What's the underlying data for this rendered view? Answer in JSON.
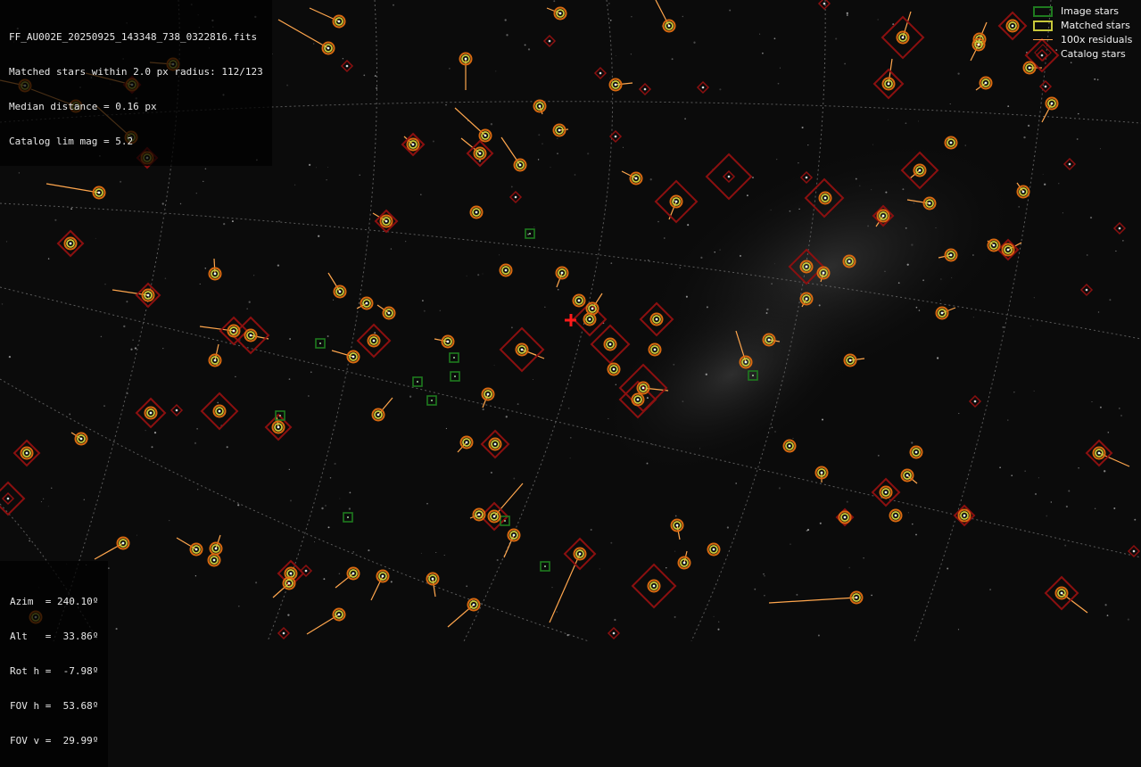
{
  "header": {
    "filename": "FF_AU002E_20250925_143348_738_0322816.fits",
    "matched_line": "Matched stars within 2.0 px radius: 112/123",
    "median_line": "Median distance = 0.16 px",
    "catalog_line": "Catalog lim mag = 5.2"
  },
  "legend": {
    "image_stars": "Image stars",
    "matched_stars": "Matched stars",
    "residuals": "100x residuals",
    "catalog_stars": "Catalog stars"
  },
  "pointing": {
    "azim": "Azim  = 240.10º",
    "alt": "Alt   =  33.86º",
    "rot": "Rot h =  -7.98º",
    "fovh": "FOV h =  53.68º",
    "fovv": "FOV v =  29.99º"
  },
  "colors": {
    "background": "#0b0b0b",
    "image_star": "#1f7a1f",
    "matched_star": "#c8c83a",
    "residual": "#ffa64d",
    "catalog_star": "#8b1010",
    "image_ring": "#d96a10",
    "radec_grid": "#6a6a6a",
    "center_marker": "#ff1a1a"
  },
  "overlay_marks": {
    "matched": [
      [
        28,
        96
      ],
      [
        85,
        119
      ],
      [
        148,
        95
      ],
      [
        194,
        72
      ],
      [
        147,
        154
      ],
      [
        165,
        177
      ],
      [
        111,
        216
      ],
      [
        79,
        273
      ],
      [
        166,
        331
      ],
      [
        241,
        307
      ],
      [
        262,
        371
      ],
      [
        281,
        376
      ],
      [
        241,
        404
      ],
      [
        169,
        463
      ],
      [
        246,
        461
      ],
      [
        312,
        479
      ],
      [
        91,
        492
      ],
      [
        30,
        508
      ],
      [
        138,
        609
      ],
      [
        220,
        616
      ],
      [
        242,
        615
      ],
      [
        240,
        628
      ],
      [
        326,
        643
      ],
      [
        324,
        654
      ],
      [
        396,
        643
      ],
      [
        429,
        646
      ],
      [
        380,
        689
      ],
      [
        485,
        649
      ],
      [
        531,
        678
      ],
      [
        380,
        24
      ],
      [
        368,
        54
      ],
      [
        522,
        66
      ],
      [
        463,
        162
      ],
      [
        544,
        152
      ],
      [
        538,
        172
      ],
      [
        583,
        185
      ],
      [
        534,
        238
      ],
      [
        433,
        248
      ],
      [
        381,
        327
      ],
      [
        411,
        340
      ],
      [
        436,
        351
      ],
      [
        419,
        382
      ],
      [
        396,
        400
      ],
      [
        502,
        383
      ],
      [
        547,
        442
      ],
      [
        424,
        465
      ],
      [
        523,
        496
      ],
      [
        555,
        498
      ],
      [
        537,
        577
      ],
      [
        554,
        579
      ],
      [
        576,
        600
      ],
      [
        628,
        15
      ],
      [
        750,
        29
      ],
      [
        690,
        95
      ],
      [
        605,
        119
      ],
      [
        627,
        146
      ],
      [
        713,
        200
      ],
      [
        758,
        226
      ],
      [
        567,
        303
      ],
      [
        630,
        306
      ],
      [
        649,
        337
      ],
      [
        664,
        346
      ],
      [
        661,
        358
      ],
      [
        684,
        386
      ],
      [
        736,
        358
      ],
      [
        734,
        392
      ],
      [
        688,
        414
      ],
      [
        721,
        435
      ],
      [
        715,
        448
      ],
      [
        585,
        392
      ],
      [
        650,
        621
      ],
      [
        733,
        657
      ],
      [
        759,
        589
      ],
      [
        767,
        631
      ],
      [
        800,
        616
      ],
      [
        836,
        406
      ],
      [
        862,
        381
      ],
      [
        885,
        500
      ],
      [
        921,
        530
      ],
      [
        960,
        670
      ],
      [
        1012,
        42
      ],
      [
        996,
        94
      ],
      [
        1031,
        191
      ],
      [
        1066,
        160
      ],
      [
        1042,
        228
      ],
      [
        925,
        222
      ],
      [
        990,
        242
      ],
      [
        904,
        299
      ],
      [
        923,
        306
      ],
      [
        952,
        293
      ],
      [
        904,
        335
      ],
      [
        953,
        404
      ],
      [
        1066,
        286
      ],
      [
        1056,
        351
      ],
      [
        1114,
        275
      ],
      [
        1130,
        280
      ],
      [
        1135,
        29
      ],
      [
        1098,
        44
      ],
      [
        1097,
        50
      ],
      [
        1105,
        93
      ],
      [
        1154,
        76
      ],
      [
        1179,
        116
      ],
      [
        1147,
        215
      ],
      [
        1027,
        507
      ],
      [
        1017,
        533
      ],
      [
        993,
        552
      ],
      [
        1004,
        578
      ],
      [
        947,
        580
      ],
      [
        1081,
        578
      ],
      [
        1232,
        508
      ],
      [
        1190,
        665
      ],
      [
        40,
        692
      ]
    ],
    "catalog": [
      [
        924,
        4
      ],
      [
        616,
        46
      ],
      [
        389,
        74
      ],
      [
        673,
        82
      ],
      [
        723,
        100
      ],
      [
        788,
        98
      ],
      [
        690,
        153
      ],
      [
        578,
        221
      ],
      [
        904,
        199
      ],
      [
        1199,
        184
      ],
      [
        1255,
        256
      ],
      [
        1218,
        325
      ],
      [
        1172,
        97
      ],
      [
        1168,
        62
      ],
      [
        1093,
        450
      ],
      [
        198,
        460
      ],
      [
        343,
        640
      ],
      [
        318,
        710
      ],
      [
        688,
        710
      ],
      [
        1271,
        618
      ],
      [
        9,
        559
      ],
      [
        817,
        198
      ]
    ],
    "residuals": [
      [
        [
          28,
          96
        ],
        [
          0,
          90
        ]
      ],
      [
        [
          85,
          119
        ],
        [
          35,
          100
        ]
      ],
      [
        [
          148,
          95
        ],
        [
          96,
          82
        ]
      ],
      [
        [
          194,
          72
        ],
        [
          168,
          70
        ]
      ],
      [
        [
          147,
          154
        ],
        [
          107,
          118
        ]
      ],
      [
        [
          111,
          216
        ],
        [
          52,
          206
        ]
      ],
      [
        [
          166,
          331
        ],
        [
          126,
          325
        ]
      ],
      [
        [
          241,
          307
        ],
        [
          240,
          290
        ]
      ],
      [
        [
          262,
          371
        ],
        [
          224,
          366
        ]
      ],
      [
        [
          281,
          376
        ],
        [
          301,
          380
        ]
      ],
      [
        [
          241,
          404
        ],
        [
          245,
          386
        ]
      ],
      [
        [
          312,
          479
        ],
        [
          310,
          466
        ]
      ],
      [
        [
          91,
          492
        ],
        [
          80,
          485
        ]
      ],
      [
        [
          138,
          609
        ],
        [
          106,
          627
        ]
      ],
      [
        [
          220,
          616
        ],
        [
          198,
          603
        ]
      ],
      [
        [
          242,
          615
        ],
        [
          247,
          600
        ]
      ],
      [
        [
          324,
          654
        ],
        [
          306,
          670
        ]
      ],
      [
        [
          396,
          643
        ],
        [
          376,
          659
        ]
      ],
      [
        [
          429,
          646
        ],
        [
          416,
          673
        ]
      ],
      [
        [
          380,
          689
        ],
        [
          344,
          711
        ]
      ],
      [
        [
          485,
          649
        ],
        [
          488,
          669
        ]
      ],
      [
        [
          531,
          678
        ],
        [
          502,
          703
        ]
      ],
      [
        [
          380,
          24
        ],
        [
          347,
          9
        ]
      ],
      [
        [
          368,
          54
        ],
        [
          312,
          22
        ]
      ],
      [
        [
          522,
          66
        ],
        [
          522,
          101
        ]
      ],
      [
        [
          463,
          162
        ],
        [
          453,
          153
        ]
      ],
      [
        [
          544,
          152
        ],
        [
          510,
          121
        ]
      ],
      [
        [
          538,
          172
        ],
        [
          517,
          155
        ]
      ],
      [
        [
          583,
          185
        ],
        [
          562,
          154
        ]
      ],
      [
        [
          433,
          248
        ],
        [
          418,
          239
        ]
      ],
      [
        [
          381,
          327
        ],
        [
          368,
          306
        ]
      ],
      [
        [
          411,
          340
        ],
        [
          400,
          346
        ]
      ],
      [
        [
          436,
          351
        ],
        [
          423,
          342
        ]
      ],
      [
        [
          396,
          400
        ],
        [
          372,
          393
        ]
      ],
      [
        [
          502,
          383
        ],
        [
          487,
          380
        ]
      ],
      [
        [
          547,
          442
        ],
        [
          541,
          457
        ]
      ],
      [
        [
          424,
          465
        ],
        [
          440,
          446
        ]
      ],
      [
        [
          523,
          496
        ],
        [
          513,
          507
        ]
      ],
      [
        [
          537,
          577
        ],
        [
          527,
          581
        ]
      ],
      [
        [
          554,
          579
        ],
        [
          586,
          542
        ]
      ],
      [
        [
          576,
          600
        ],
        [
          565,
          625
        ]
      ],
      [
        [
          628,
          15
        ],
        [
          613,
          9
        ]
      ],
      [
        [
          750,
          29
        ],
        [
          735,
          0
        ]
      ],
      [
        [
          690,
          95
        ],
        [
          709,
          93
        ]
      ],
      [
        [
          605,
          119
        ],
        [
          608,
          128
        ]
      ],
      [
        [
          627,
          146
        ],
        [
          637,
          145
        ]
      ],
      [
        [
          713,
          200
        ],
        [
          697,
          192
        ]
      ],
      [
        [
          758,
          226
        ],
        [
          750,
          246
        ]
      ],
      [
        [
          630,
          306
        ],
        [
          624,
          322
        ]
      ],
      [
        [
          664,
          346
        ],
        [
          675,
          329
        ]
      ],
      [
        [
          721,
          435
        ],
        [
          749,
          438
        ]
      ],
      [
        [
          585,
          392
        ],
        [
          610,
          402
        ]
      ],
      [
        [
          650,
          621
        ],
        [
          616,
          698
        ]
      ],
      [
        [
          759,
          589
        ],
        [
          762,
          605
        ]
      ],
      [
        [
          767,
          631
        ],
        [
          770,
          618
        ]
      ],
      [
        [
          836,
          406
        ],
        [
          825,
          371
        ]
      ],
      [
        [
          862,
          381
        ],
        [
          874,
          383
        ]
      ],
      [
        [
          921,
          530
        ],
        [
          921,
          541
        ]
      ],
      [
        [
          960,
          670
        ],
        [
          862,
          676
        ]
      ],
      [
        [
          1012,
          42
        ],
        [
          1021,
          13
        ]
      ],
      [
        [
          996,
          94
        ],
        [
          1000,
          66
        ]
      ],
      [
        [
          1031,
          191
        ],
        [
          1020,
          200
        ]
      ],
      [
        [
          1042,
          228
        ],
        [
          1017,
          224
        ]
      ],
      [
        [
          990,
          242
        ],
        [
          982,
          254
        ]
      ],
      [
        [
          923,
          306
        ],
        [
          920,
          316
        ]
      ],
      [
        [
          904,
          335
        ],
        [
          899,
          344
        ]
      ],
      [
        [
          953,
          404
        ],
        [
          969,
          402
        ]
      ],
      [
        [
          1066,
          286
        ],
        [
          1052,
          289
        ]
      ],
      [
        [
          1056,
          351
        ],
        [
          1071,
          345
        ]
      ],
      [
        [
          1114,
          275
        ],
        [
          1107,
          270
        ]
      ],
      [
        [
          1130,
          280
        ],
        [
          1145,
          272
        ]
      ],
      [
        [
          1098,
          44
        ],
        [
          1106,
          25
        ]
      ],
      [
        [
          1097,
          50
        ],
        [
          1088,
          68
        ]
      ],
      [
        [
          1105,
          93
        ],
        [
          1094,
          101
        ]
      ],
      [
        [
          1154,
          76
        ],
        [
          1168,
          76
        ]
      ],
      [
        [
          1179,
          116
        ],
        [
          1168,
          137
        ]
      ],
      [
        [
          1147,
          215
        ],
        [
          1140,
          205
        ]
      ],
      [
        [
          1017,
          533
        ],
        [
          1028,
          542
        ]
      ],
      [
        [
          1232,
          508
        ],
        [
          1266,
          523
        ]
      ],
      [
        [
          1190,
          665
        ],
        [
          1219,
          687
        ]
      ],
      [
        [
          585,
          392
        ],
        [
          601,
          398
        ]
      ]
    ],
    "image_only": [
      [
        594,
        262
      ],
      [
        359,
        385
      ],
      [
        509,
        401
      ],
      [
        468,
        428
      ],
      [
        510,
        422
      ],
      [
        484,
        449
      ],
      [
        314,
        466
      ],
      [
        844,
        421
      ],
      [
        390,
        580
      ],
      [
        566,
        584
      ],
      [
        611,
        635
      ]
    ],
    "diamonds": [
      [
        [
          148,
          95
        ],
        9
      ],
      [
        [
          165,
          177
        ],
        11
      ],
      [
        [
          79,
          273
        ],
        14
      ],
      [
        [
          166,
          331
        ],
        13
      ],
      [
        [
          262,
          371
        ],
        15
      ],
      [
        [
          281,
          376
        ],
        20
      ],
      [
        [
          169,
          463
        ],
        16
      ],
      [
        [
          246,
          461
        ],
        20
      ],
      [
        [
          312,
          479
        ],
        14
      ],
      [
        [
          30,
          508
        ],
        14
      ],
      [
        [
          326,
          643
        ],
        14
      ],
      [
        [
          463,
          162
        ],
        12
      ],
      [
        [
          538,
          172
        ],
        14
      ],
      [
        [
          433,
          248
        ],
        12
      ],
      [
        [
          419,
          382
        ],
        18
      ],
      [
        [
          555,
          498
        ],
        15
      ],
      [
        [
          554,
          579
        ],
        15
      ],
      [
        [
          585,
          392
        ],
        24
      ],
      [
        [
          661,
          358
        ],
        18
      ],
      [
        [
          684,
          386
        ],
        21
      ],
      [
        [
          736,
          358
        ],
        18
      ],
      [
        [
          721,
          435
        ],
        26
      ],
      [
        [
          715,
          448
        ],
        20
      ],
      [
        [
          650,
          621
        ],
        17
      ],
      [
        [
          733,
          657
        ],
        24
      ],
      [
        [
          758,
          226
        ],
        23
      ],
      [
        [
          924,
          222
        ],
        21
      ],
      [
        [
          904,
          299
        ],
        19
      ],
      [
        [
          1012,
          42
        ],
        23
      ],
      [
        [
          996,
          94
        ],
        16
      ],
      [
        [
          1031,
          191
        ],
        20
      ],
      [
        [
          1130,
          280
        ],
        11
      ],
      [
        [
          1135,
          29
        ],
        15
      ],
      [
        [
          993,
          552
        ],
        15
      ],
      [
        [
          947,
          580
        ],
        9
      ],
      [
        [
          1081,
          578
        ],
        11
      ],
      [
        [
          1232,
          508
        ],
        14
      ],
      [
        [
          1190,
          665
        ],
        18
      ],
      [
        [
          990,
          242
        ],
        11
      ],
      [
        [
          9,
          559
        ],
        18
      ],
      [
        [
          817,
          198
        ],
        25
      ],
      [
        [
          1168,
          62
        ],
        18
      ]
    ]
  }
}
